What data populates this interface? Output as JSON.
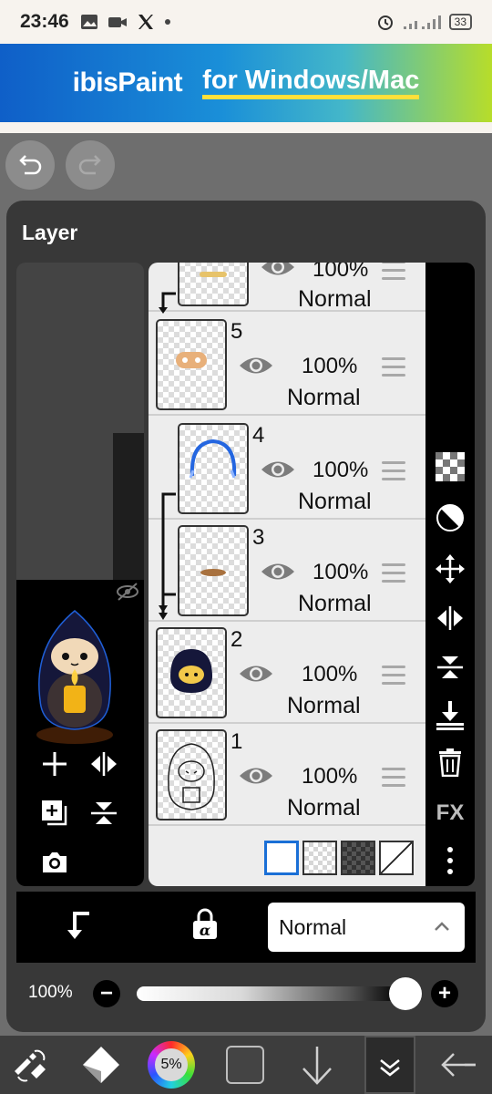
{
  "status_bar": {
    "time": "23:46",
    "battery": "33"
  },
  "banner": {
    "logo": "ibisPaint",
    "tagline": "for Windows/Mac"
  },
  "panel": {
    "title": "Layer"
  },
  "layers": [
    {
      "number": "",
      "opacity": "100%",
      "blend": "Normal"
    },
    {
      "number": "5",
      "opacity": "100%",
      "blend": "Normal"
    },
    {
      "number": "4",
      "opacity": "100%",
      "blend": "Normal"
    },
    {
      "number": "3",
      "opacity": "100%",
      "blend": "Normal"
    },
    {
      "number": "2",
      "opacity": "100%",
      "blend": "Normal"
    },
    {
      "number": "1",
      "opacity": "100%",
      "blend": "Normal"
    }
  ],
  "tools": {
    "fx_label": "FX"
  },
  "blend_bar": {
    "clipping_icon": "clip-arrow-icon",
    "alpha_lock_icon": "alpha-lock-icon",
    "selected_blend": "Normal"
  },
  "opacity": {
    "label": "100%",
    "value": 1.0
  },
  "bottom_bar": {
    "brush_size": "5%"
  },
  "colors": {
    "panel": "#383838",
    "accent_blue": "#1a6fd6",
    "banner_yellow": "#ffe03a"
  }
}
